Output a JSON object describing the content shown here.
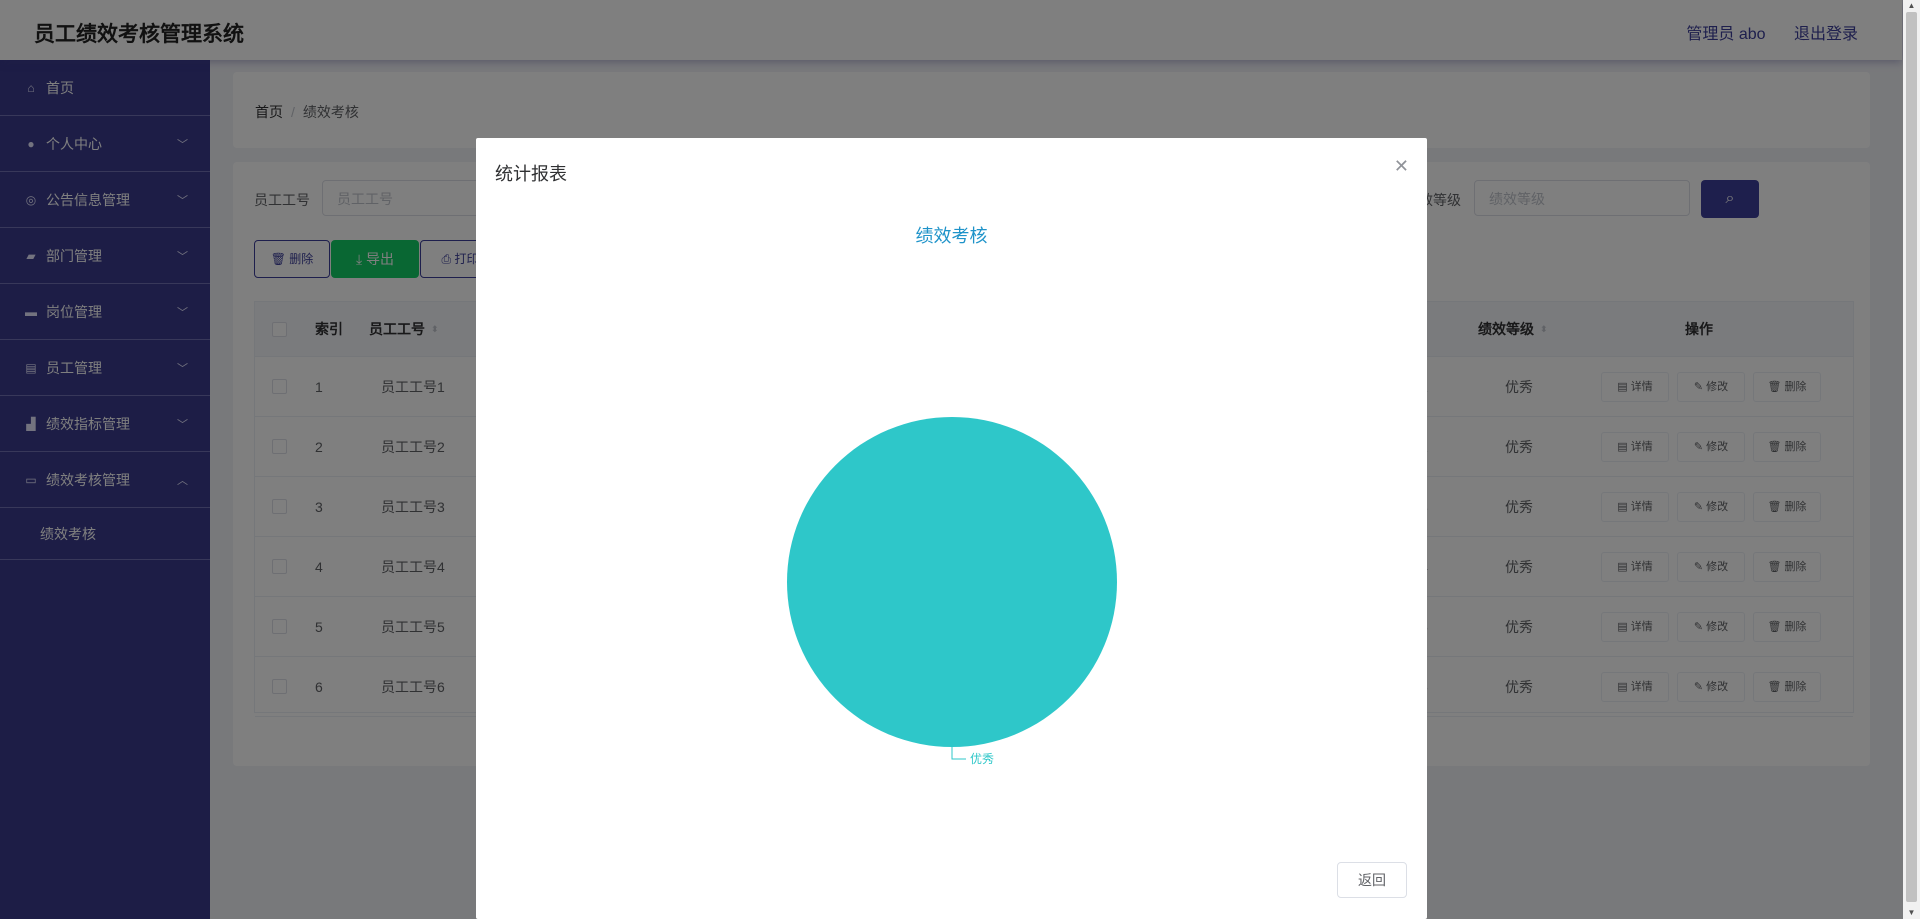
{
  "header": {
    "title": "员工绩效考核管理系统",
    "user": "管理员 abo",
    "logout": "退出登录"
  },
  "sidebar": {
    "items": [
      {
        "label": "首页",
        "icon": "home-icon"
      },
      {
        "label": "个人中心",
        "icon": "user-icon"
      },
      {
        "label": "公告信息管理",
        "icon": "compass-icon"
      },
      {
        "label": "部门管理",
        "icon": "briefcase-icon"
      },
      {
        "label": "岗位管理",
        "icon": "printer-icon"
      },
      {
        "label": "员工管理",
        "icon": "clipboard-icon"
      },
      {
        "label": "绩效指标管理",
        "icon": "chart-icon"
      },
      {
        "label": "绩效考核管理",
        "icon": "review-icon"
      }
    ],
    "sub_item": "绩效考核"
  },
  "breadcrumb": {
    "home": "首页",
    "sep": "/",
    "current": "绩效考核"
  },
  "search": {
    "label1": "员工工号",
    "placeholder1": "员工工号",
    "label2": "效等级",
    "placeholder2": "绩效等级"
  },
  "toolbar": {
    "delete": "删除",
    "export": "导出",
    "print": "打印"
  },
  "table": {
    "headers": {
      "index": "索引",
      "emp_no": "员工工号",
      "grade": "绩效等级",
      "ops": "操作"
    },
    "rows": [
      {
        "index": "1",
        "emp_no": "员工工号1",
        "partial": "1",
        "grade": "优秀"
      },
      {
        "index": "2",
        "emp_no": "员工工号2",
        "partial": "2",
        "grade": "优秀"
      },
      {
        "index": "3",
        "emp_no": "员工工号3",
        "partial": "3",
        "grade": "优秀"
      },
      {
        "index": "4",
        "emp_no": "员工工号4",
        "partial": "4",
        "grade": "优秀"
      },
      {
        "index": "5",
        "emp_no": "员工工号5",
        "partial": "5",
        "grade": "优秀"
      },
      {
        "index": "6",
        "emp_no": "员工工号6",
        "partial": "6",
        "grade": "优秀"
      }
    ],
    "op_detail": "详情",
    "op_edit": "修改",
    "op_delete": "删除"
  },
  "dialog": {
    "title": "统计报表",
    "back": "返回"
  },
  "colors": {
    "accent": "#3d3f9b",
    "export": "#13ce66",
    "pie": "#2ec7c9",
    "chart_title": "#1e93c9"
  },
  "chart_data": {
    "type": "pie",
    "title": "绩效考核",
    "categories": [
      "优秀"
    ],
    "values": [
      6
    ],
    "colors": [
      "#2ec7c9"
    ]
  }
}
